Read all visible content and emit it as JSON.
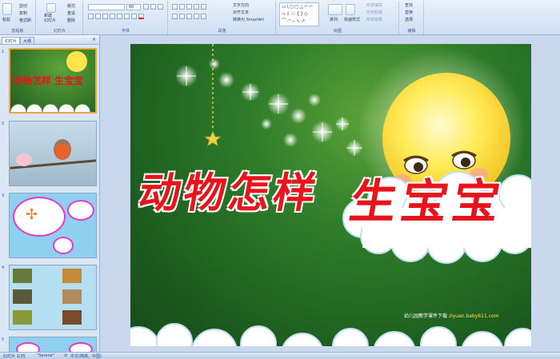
{
  "ribbon": {
    "clipboard": {
      "label": "剪贴板",
      "paste": "粘贴",
      "cut": "剪切",
      "copy": "复制",
      "format": "格式刷"
    },
    "slides": {
      "label": "幻灯片",
      "new_slide": "新建\n幻灯片",
      "layout": "版式",
      "reset": "重设",
      "delete": "删除"
    },
    "font": {
      "label": "字体",
      "font_name": "",
      "font_size": "60"
    },
    "paragraph": {
      "label": "段落",
      "text_direction": "文字方向",
      "align_text": "对齐文本",
      "smartart": "转换为 SmartArt"
    },
    "drawing": {
      "label": "绘图",
      "arrange": "排列",
      "quick_styles": "快速样式",
      "shape_fill": "形状填充",
      "shape_outline": "形状轮廓",
      "shape_effects": "形状效果"
    },
    "editing": {
      "label": "编辑",
      "find": "查找",
      "replace": "替换",
      "select": "选择"
    }
  },
  "panel": {
    "tab_slides": "幻灯片",
    "tab_outline": "大纲",
    "thumbnails": [
      {
        "num": "1"
      },
      {
        "num": "2"
      },
      {
        "num": "3"
      },
      {
        "num": "4"
      },
      {
        "num": "5"
      }
    ]
  },
  "slide": {
    "title_part1": "动物怎样",
    "title_part2": "生宝宝",
    "watermark_label": "幼儿园教学课件下载",
    "watermark_url": "ziyuan.baby611.com"
  },
  "status": {
    "slide_count": "幻灯片 1/35",
    "theme": "\"Serene\"",
    "language": "中文(简体，中国)"
  },
  "colors": {
    "title_red": "#e8141b",
    "title_outline": "#ffffff",
    "moon": "#ffe44d",
    "slide_green": "#2f7d2a"
  }
}
